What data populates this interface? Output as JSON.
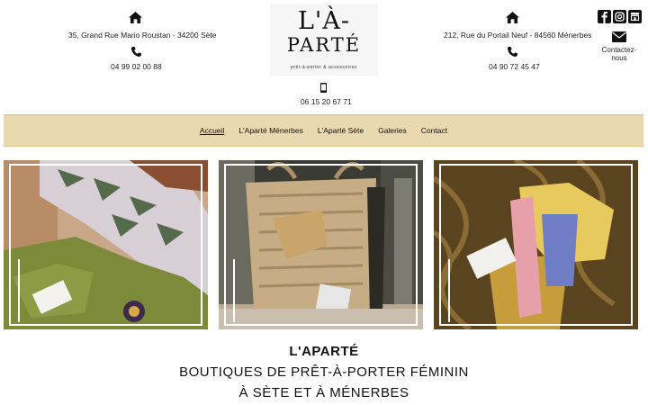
{
  "shop_left": {
    "icon": "home-icon",
    "address": "35, Grand Rue Mario Roustan - 34200 Sète",
    "phone_icon": "phone-icon",
    "phone": "04 99 02 00 88"
  },
  "logo": {
    "line1": "L'À-",
    "line2": "PARTÉ",
    "tagline": "prêt-à-porter & accessoires"
  },
  "mobile": {
    "icon": "mobile-phone-icon",
    "phone": "06 15 20 67 71"
  },
  "shop_right": {
    "icon": "home-icon",
    "address": "212, Rue du Portail Neuf - 84560 Ménerbes",
    "phone_icon": "phone-icon",
    "phone": "04 90 72 45 47"
  },
  "social": {
    "icons": [
      "facebook-icon",
      "instagram-icon",
      "store-icon"
    ],
    "contact_icon": "envelope-icon",
    "contact_line1": "Contactez-",
    "contact_line2": "nous"
  },
  "nav": {
    "items": [
      "Accueil",
      "L'Aparté Ménerbes",
      "L'Aparté Sète",
      "Galeries",
      "Contact"
    ],
    "active": "Accueil"
  },
  "gallery": {
    "photos": [
      "clothing-display-photo",
      "woven-bag-photo",
      "scarf-bag-photo"
    ]
  },
  "headline": {
    "brand": "L'APARTÉ",
    "line1": "BOUTIQUES DE PRÊT-À-PORTER FÉMININ",
    "line2": "À SÈTE ET À MÉNERBES"
  },
  "colors": {
    "nav_bg": "#ead9b0",
    "text": "#111111"
  }
}
